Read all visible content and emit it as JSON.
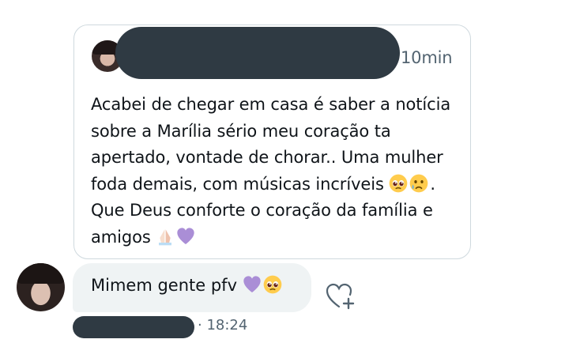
{
  "quoted_tweet": {
    "time": "10min",
    "text_parts": [
      "Acabei de chegar em casa é saber a notícia sobre a Marília sério meu coração ta apertado, vontade de chorar.. Uma mulher foda demais, com músicas incríveis ",
      ". Que Deus conforte o coração da família e amigos "
    ],
    "emojis_mid": [
      "pleading-face-icon",
      "crying-face-icon"
    ],
    "emojis_end": [
      "folded-hands-icon",
      "purple-heart-icon"
    ]
  },
  "reply": {
    "text": "Mimem gente pfv ",
    "emojis": [
      "purple-heart-icon",
      "pleading-face-icon"
    ],
    "time": "· 18:24"
  },
  "colors": {
    "bubble": "#eff3f4",
    "secondary_text": "#536471",
    "border": "#cfd9de",
    "redaction": "#2f3a43",
    "purple_heart": "#aa8ed6"
  }
}
